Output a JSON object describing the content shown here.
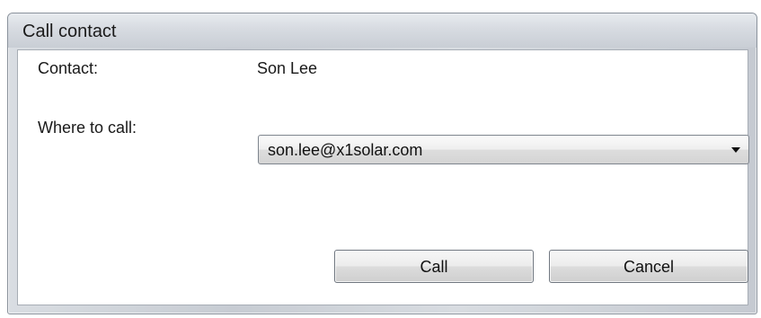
{
  "dialog": {
    "title": "Call contact",
    "contact_label": "Contact:",
    "contact_value": "Son Lee",
    "where_label": "Where to call:",
    "where_value": "son.lee@x1solar.com",
    "call_label": "Call",
    "cancel_label": "Cancel"
  }
}
